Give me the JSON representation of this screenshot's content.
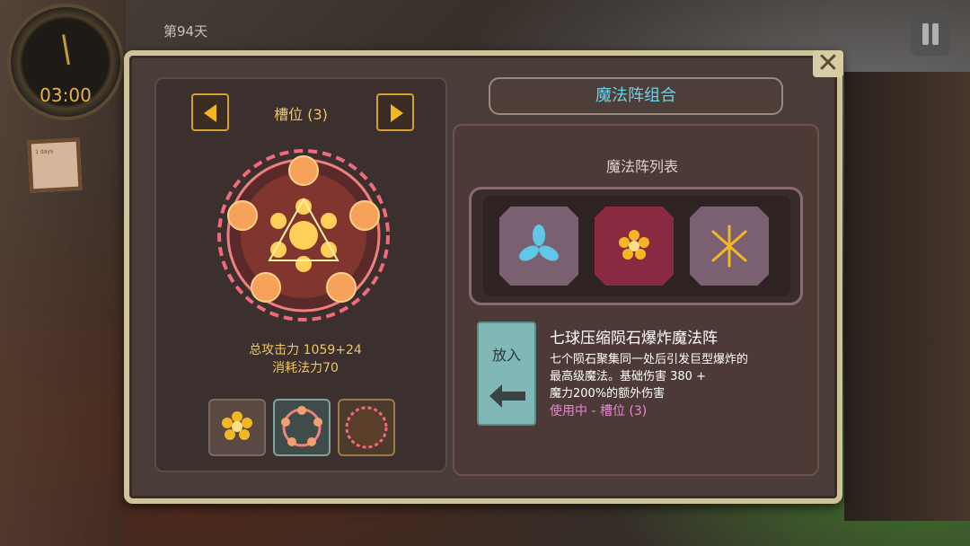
{
  "hud": {
    "clock_time": "03:00",
    "day_label": "第94天",
    "note_text": "1 days"
  },
  "panel": {
    "title": "魔法阵组合",
    "close_glyph": "✕"
  },
  "slot": {
    "title": "槽位 (3)",
    "total_attack": "总攻击力 1059+24",
    "mana_cost": "消耗法力70"
  },
  "list": {
    "title": "魔法阵列表",
    "items": [
      {
        "icon": "tri-leaf-icon",
        "color": "#5fc8e8"
      },
      {
        "icon": "flower-icon",
        "color": "#f3b724"
      },
      {
        "icon": "star-burst-icon",
        "color": "#f3b724"
      }
    ]
  },
  "detail": {
    "put_label": "放入",
    "name": "七球压缩陨石爆炸魔法阵",
    "desc_line1": "七个陨石聚集同一处后引发巨型爆炸的",
    "desc_line2": "最高级魔法。基础伤害 380 +",
    "desc_line3": "魔力200%的额外伤害",
    "status": "使用中 - 槽位 (3)"
  },
  "colors": {
    "accent_gold": "#efc56a",
    "accent_cyan": "#6ad3e8",
    "status_pink": "#e38ad0",
    "circle_pink": "#f06a7a"
  }
}
